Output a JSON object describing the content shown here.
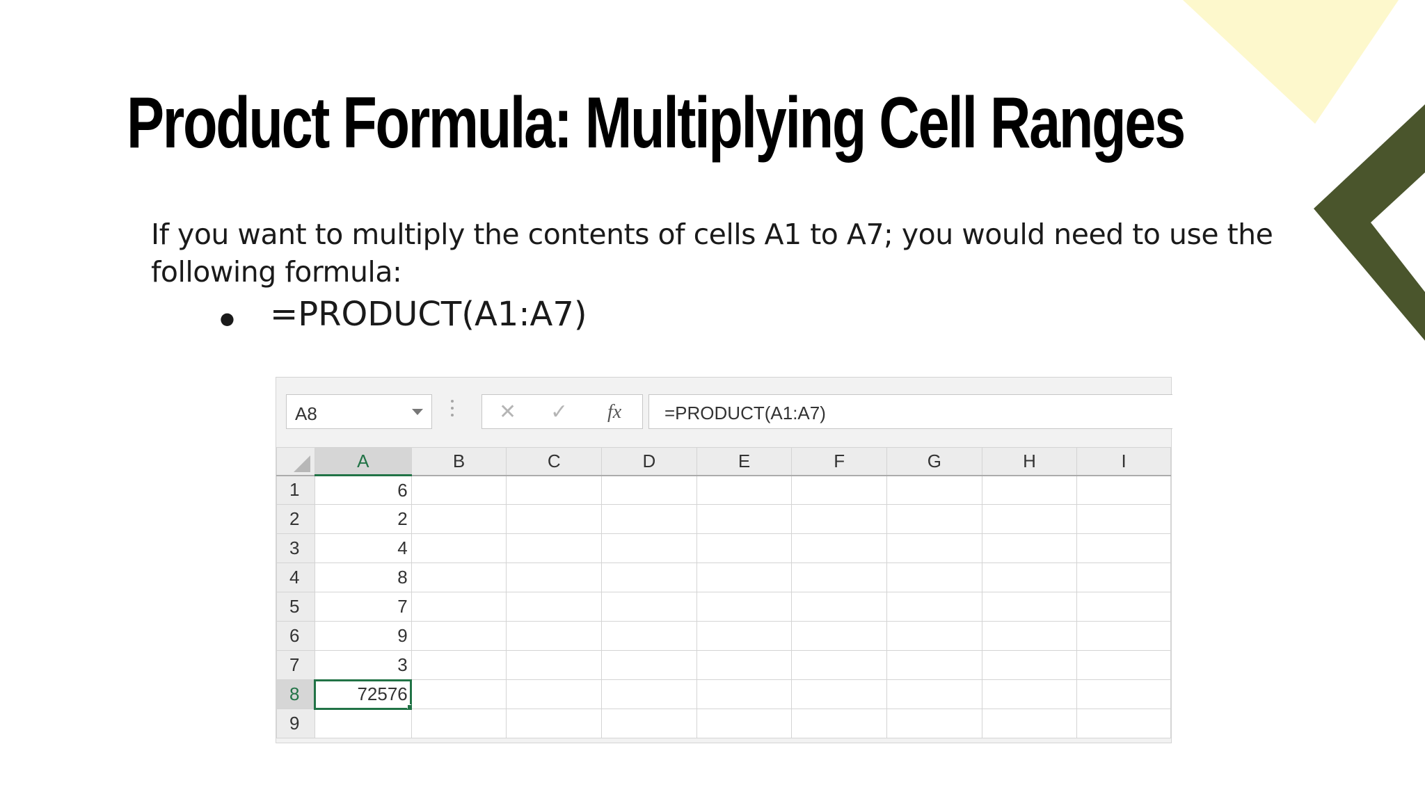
{
  "slide": {
    "title": "Product Formula: Multiplying Cell Ranges",
    "body": "If you want to multiply the contents of cells A1 to A7; you would need to use the following formula:",
    "bullet": "=PRODUCT(A1:A7)",
    "colors": {
      "accent_yellow": "#fdf8cc",
      "accent_olive": "#4a552c"
    }
  },
  "spreadsheet": {
    "name_box": "A8",
    "formula": "=PRODUCT(A1:A7)",
    "buttons": {
      "cancel": "✕",
      "enter": "✓",
      "fx": "fx"
    },
    "columns": [
      "A",
      "B",
      "C",
      "D",
      "E",
      "F",
      "G",
      "H",
      "I"
    ],
    "rows": [
      {
        "num": "1",
        "a": "6"
      },
      {
        "num": "2",
        "a": "2"
      },
      {
        "num": "3",
        "a": "4"
      },
      {
        "num": "4",
        "a": "8"
      },
      {
        "num": "5",
        "a": "7"
      },
      {
        "num": "6",
        "a": "9"
      },
      {
        "num": "7",
        "a": "3"
      },
      {
        "num": "8",
        "a": "72576"
      },
      {
        "num": "9",
        "a": ""
      }
    ],
    "selected_cell": "A8",
    "accent": "#217346"
  }
}
